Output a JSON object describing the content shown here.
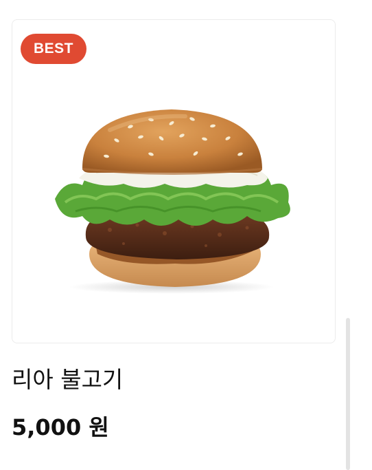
{
  "product": {
    "badge": "BEST",
    "name": "리아 불고기",
    "price": "5,000 원",
    "image_icon": "burger-image"
  },
  "colors": {
    "badge_bg": "#e04a32",
    "text": "#111111",
    "card_border": "#ebebeb"
  }
}
